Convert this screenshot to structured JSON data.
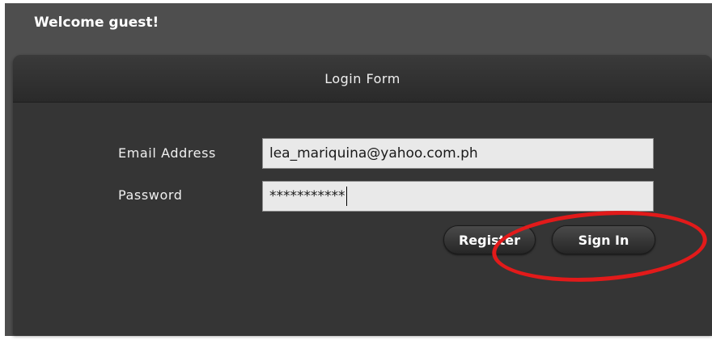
{
  "header": {
    "welcome": "Welcome guest!"
  },
  "form": {
    "title": "Login Form",
    "email_label": "Email Address",
    "email_value": "lea_mariquina@yahoo.com.ph",
    "password_label": "Password",
    "password_value": "***********",
    "register_label": "Register",
    "signin_label": "Sign In"
  },
  "annotation": {
    "color": "#e21a1a",
    "shape": "ellipse around Sign In button"
  }
}
